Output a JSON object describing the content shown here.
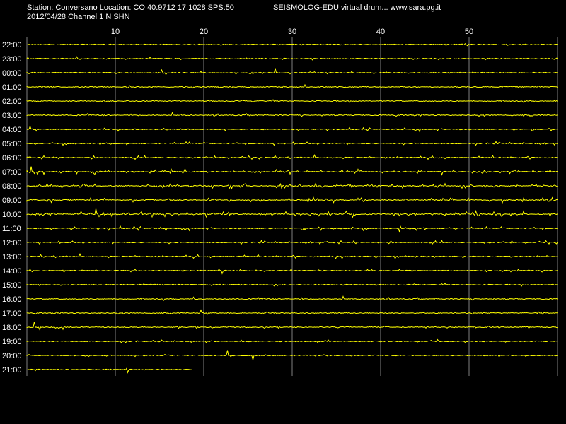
{
  "header": {
    "station_line": "Station: Conversano Location: CO 40.9712 17.1028 SPS:50",
    "title": "SEISMOLOG-EDU virtual drum... www.sara.pg.it",
    "date_channel": "2012/04/28  Channel 1 N SHN"
  },
  "minute_ticks": [
    "10",
    "20",
    "30",
    "40",
    "50"
  ],
  "hour_labels": [
    "22:00",
    "23:00",
    "00:00",
    "01:00",
    "02:00",
    "03:00",
    "04:00",
    "05:00",
    "06:00",
    "07:00",
    "08:00",
    "09:00",
    "10:00",
    "11:00",
    "12:00",
    "13:00",
    "14:00",
    "15:00",
    "16:00",
    "17:00",
    "18:00",
    "19:00",
    "20:00",
    "21:00"
  ],
  "trace": {
    "color": "#ffff00",
    "last_row_fraction_recorded": 0.31,
    "activity_levels": [
      0.12,
      0.12,
      0.2,
      0.12,
      0.12,
      0.15,
      0.25,
      0.3,
      0.35,
      0.55,
      0.6,
      0.55,
      0.7,
      0.4,
      0.3,
      0.35,
      0.2,
      0.15,
      0.15,
      0.15,
      0.12,
      0.12,
      0.12,
      0.12
    ]
  },
  "colors": {
    "background": "#000000",
    "grid": "#808080",
    "text": "#ffffff"
  }
}
